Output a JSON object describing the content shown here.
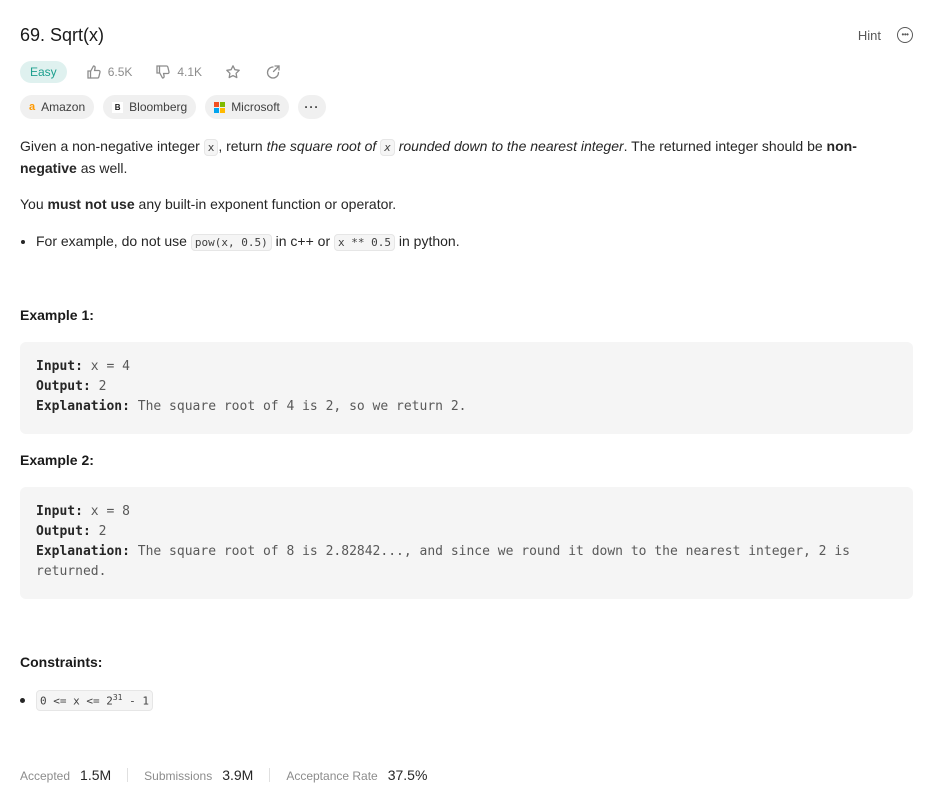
{
  "problem": {
    "title": "69. Sqrt(x)",
    "hint_label": "Hint",
    "difficulty": "Easy",
    "likes": "6.5K",
    "dislikes": "4.1K"
  },
  "companies": [
    {
      "name": "Amazon"
    },
    {
      "name": "Bloomberg"
    },
    {
      "name": "Microsoft"
    }
  ],
  "companies_more": "···",
  "description": {
    "p1_a": "Given a non-negative integer ",
    "p1_code": "x",
    "p1_b": ", return ",
    "p1_em1": "the square root of ",
    "p1_code2": "x",
    "p1_em2": " rounded down to the nearest integer",
    "p1_c": ". The returned integer should be ",
    "p1_strong": "non-negative",
    "p1_d": " as well.",
    "p2_a": "You ",
    "p2_strong": "must not use",
    "p2_b": " any built-in exponent function or operator.",
    "bullet_a": "For example, do not use ",
    "bullet_code1": "pow(x, 0.5)",
    "bullet_b": " in c++ or ",
    "bullet_code2": "x ** 0.5",
    "bullet_c": " in python."
  },
  "examples": [
    {
      "title": "Example 1:",
      "input_label": "Input:",
      "input": " x = 4",
      "output_label": "Output:",
      "output": " 2",
      "explanation_label": "Explanation:",
      "explanation": " The square root of 4 is 2, so we return 2."
    },
    {
      "title": "Example 2:",
      "input_label": "Input:",
      "input": " x = 8",
      "output_label": "Output:",
      "output": " 2",
      "explanation_label": "Explanation:",
      "explanation": " The square root of 8 is 2.82842..., and since we round it down to the nearest integer, 2 is returned."
    }
  ],
  "constraints": {
    "title": "Constraints:",
    "c1_a": "0 <= x <= 2",
    "c1_sup": "31",
    "c1_b": " - 1"
  },
  "stats": {
    "accepted_label": "Accepted",
    "accepted_value": "1.5M",
    "submissions_label": "Submissions",
    "submissions_value": "3.9M",
    "rate_label": "Acceptance Rate",
    "rate_value": "37.5%"
  }
}
